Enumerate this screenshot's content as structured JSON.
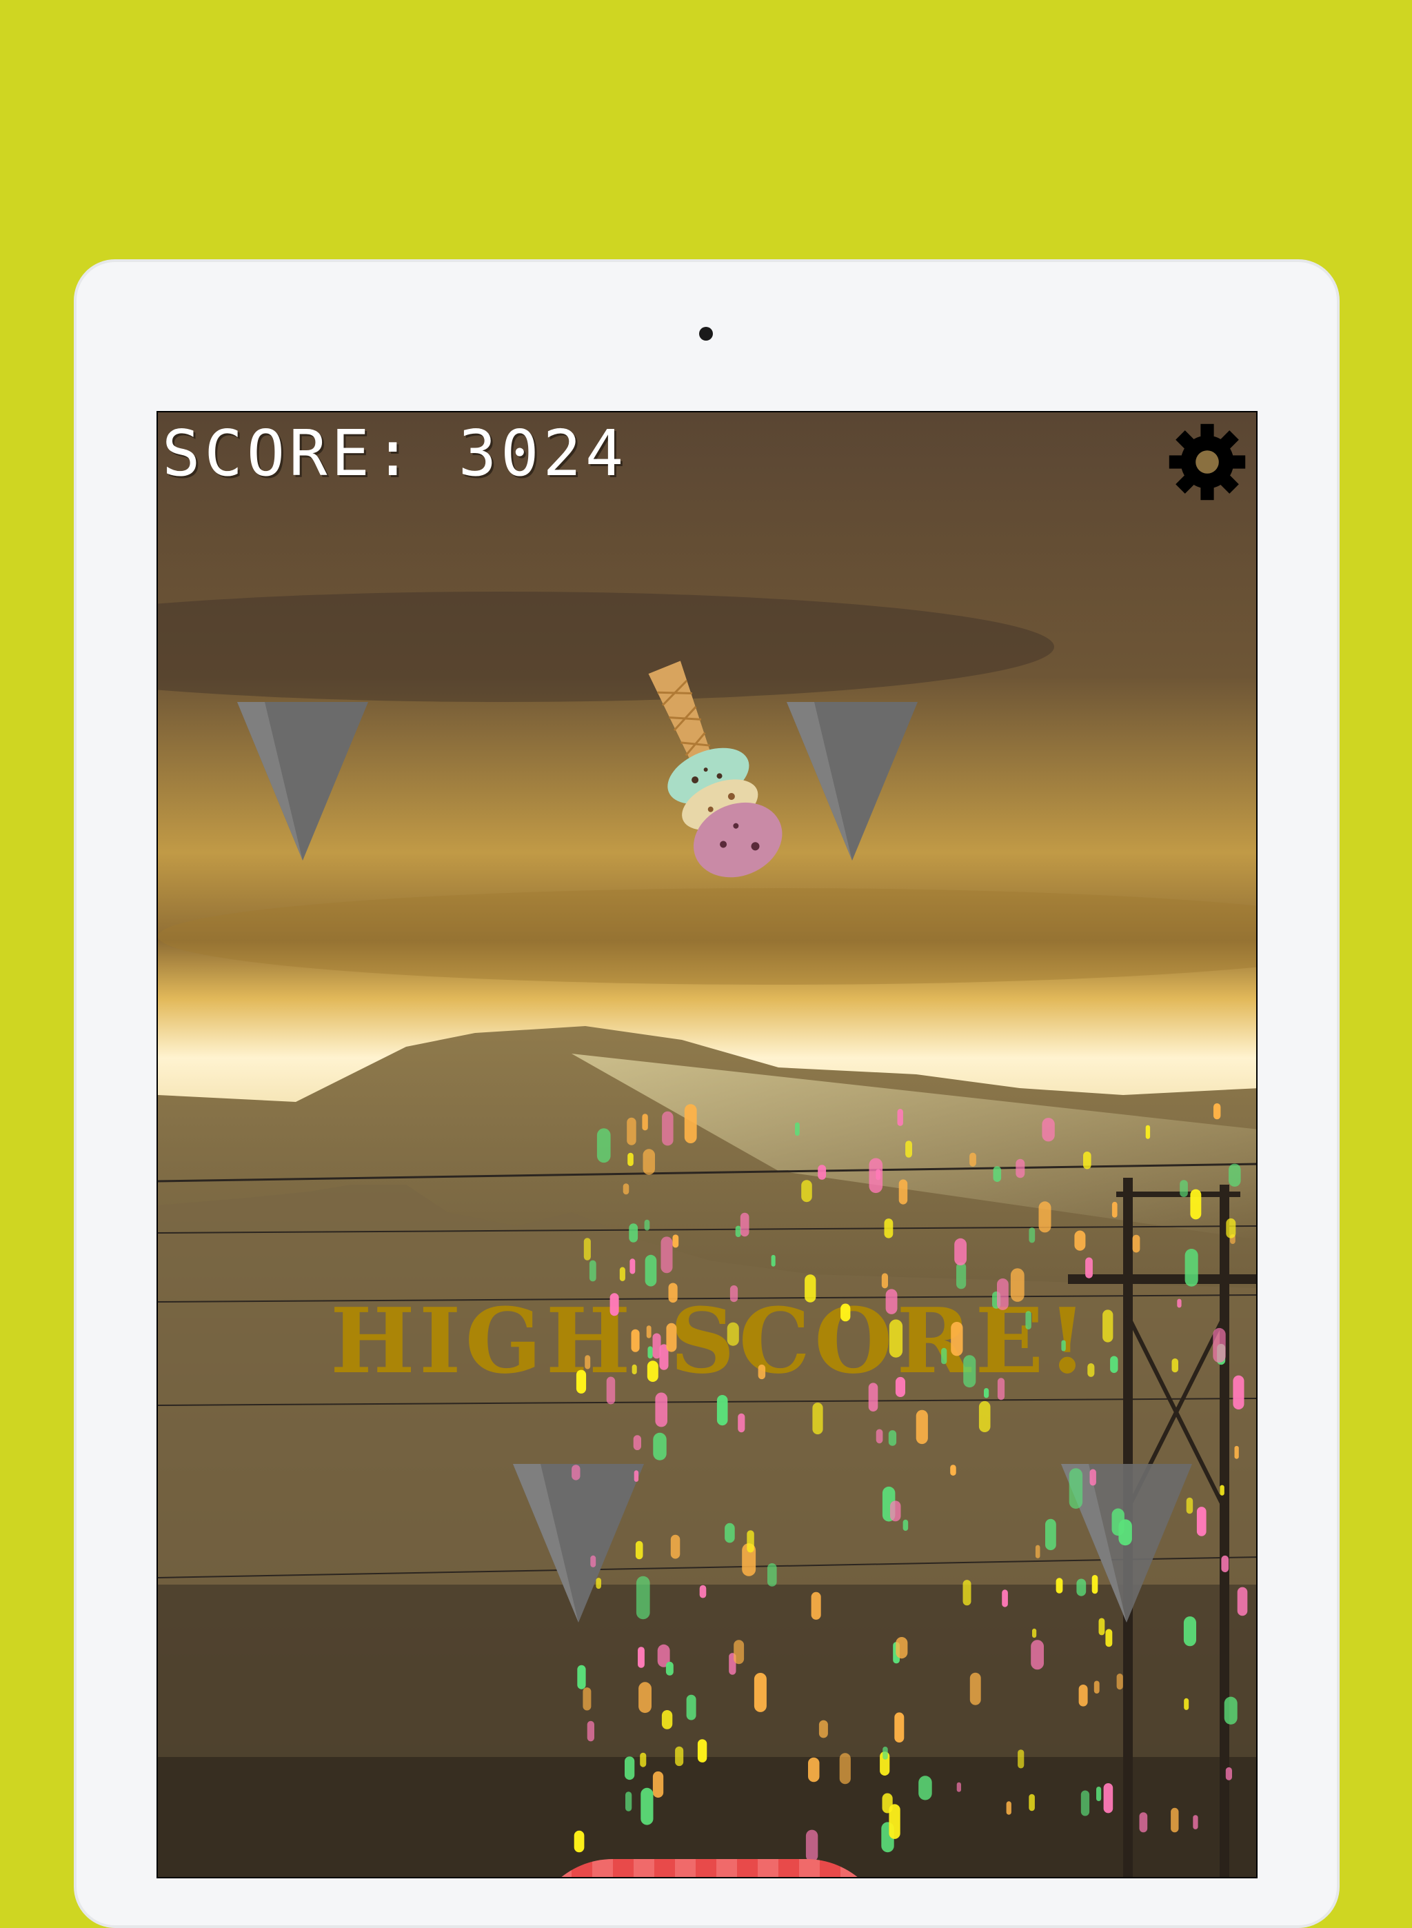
{
  "hud": {
    "score_text": "SCORE: 3024"
  },
  "banner": {
    "high_score_text": "HIGH SCORE!"
  },
  "icons": {
    "settings": "gear-icon",
    "player": "ice-cream-cone",
    "obstacle": "triangle-spike"
  },
  "colors": {
    "background": "#cfd622",
    "device_frame": "#f5f6f8",
    "score_text": "#ffffff",
    "banner_text": "#b38a00",
    "spike": "#6b6b6b",
    "confetti": [
      "#fff21a",
      "#5be07a",
      "#ff7ab8",
      "#ffb347"
    ]
  }
}
